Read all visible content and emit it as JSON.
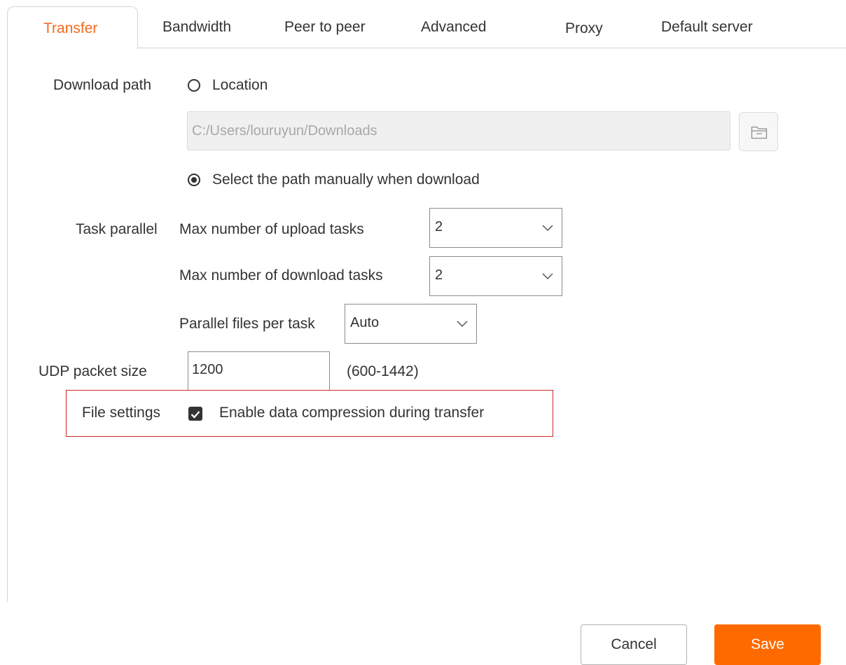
{
  "tabs": [
    {
      "label": "Transfer",
      "active": true
    },
    {
      "label": "Bandwidth",
      "active": false
    },
    {
      "label": "Peer to peer",
      "active": false
    },
    {
      "label": "Advanced",
      "active": false
    },
    {
      "label": "Proxy",
      "active": false
    },
    {
      "label": "Default server",
      "active": false
    }
  ],
  "download_path": {
    "label": "Download path",
    "location_option": "Location",
    "location_selected": false,
    "path_value": "C:/Users/louruyun/Downloads",
    "path_disabled": true,
    "folder_button_icon": "folder-icon",
    "manual_option": "Select the path manually when download",
    "manual_selected": true
  },
  "task_parallel": {
    "label": "Task parallel",
    "upload_label": "Max number of upload tasks",
    "upload_value": "2",
    "download_label": "Max number of download tasks",
    "download_value": "2",
    "files_label": "Parallel files per task",
    "files_value": "Auto"
  },
  "udp": {
    "label": "UDP packet size",
    "value": "1200",
    "range": "(600-1442)"
  },
  "file_settings": {
    "label": "File settings",
    "compression_label": "Enable data compression during transfer",
    "compression_checked": true
  },
  "buttons": {
    "cancel": "Cancel",
    "save": "Save"
  },
  "colors": {
    "accent": "#f26a1b",
    "save_button": "#ff6a00",
    "highlight_border": "#d02626"
  }
}
